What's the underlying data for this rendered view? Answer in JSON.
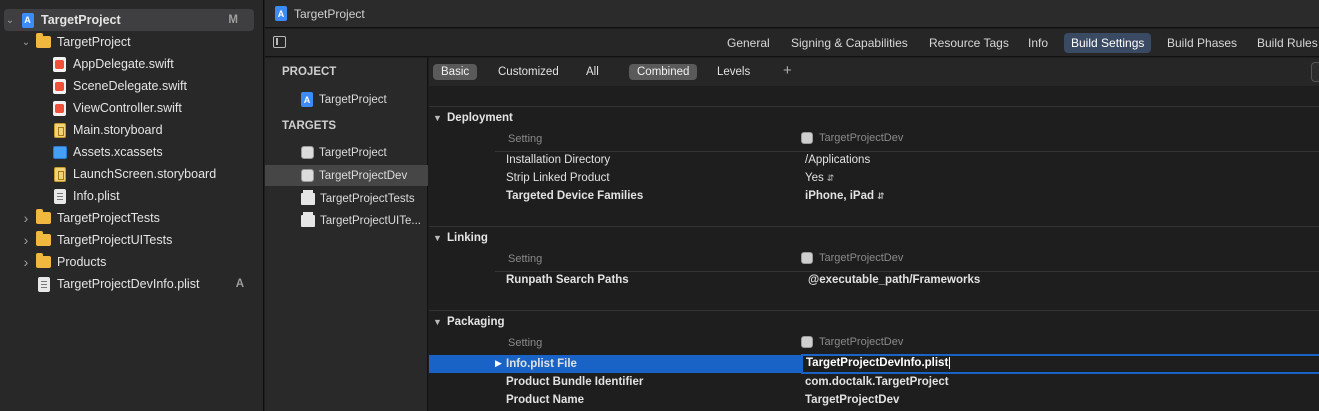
{
  "navigator": {
    "items": [
      {
        "label": "TargetProject",
        "icon": "project-icon",
        "badge": "M",
        "level": 0,
        "expanded": true,
        "bold": true,
        "selected": true
      },
      {
        "label": "TargetProject",
        "icon": "folder-icon",
        "level": 1,
        "expanded": true
      },
      {
        "label": "AppDelegate.swift",
        "icon": "swift-file-icon",
        "level": 2
      },
      {
        "label": "SceneDelegate.swift",
        "icon": "swift-file-icon",
        "level": 2
      },
      {
        "label": "ViewController.swift",
        "icon": "swift-file-icon",
        "level": 2
      },
      {
        "label": "Main.storyboard",
        "icon": "storyboard-icon",
        "level": 2
      },
      {
        "label": "Assets.xcassets",
        "icon": "assets-icon",
        "level": 2
      },
      {
        "label": "LaunchScreen.storyboard",
        "icon": "storyboard-icon",
        "level": 2
      },
      {
        "label": "Info.plist",
        "icon": "plist-icon",
        "level": 2
      },
      {
        "label": "TargetProjectTests",
        "icon": "folder-icon",
        "level": 1,
        "expanded": false
      },
      {
        "label": "TargetProjectUITests",
        "icon": "folder-icon",
        "level": 1,
        "expanded": false
      },
      {
        "label": "Products",
        "icon": "folder-icon",
        "level": 1,
        "expanded": false
      },
      {
        "label": "TargetProjectDevInfo.plist",
        "icon": "plist-icon",
        "badge": "A",
        "level": 1
      }
    ]
  },
  "titlebar": {
    "title": "TargetProject"
  },
  "tabs": [
    "General",
    "Signing & Capabilities",
    "Resource Tags",
    "Info",
    "Build Settings",
    "Build Phases",
    "Build Rules"
  ],
  "active_tab": "Build Settings",
  "targets_panel": {
    "project_header": "PROJECT",
    "project_item": "TargetProject",
    "targets_header": "TARGETS",
    "targets": [
      {
        "label": "TargetProject",
        "icon": "app-target-icon"
      },
      {
        "label": "TargetProjectDev",
        "icon": "app-target-icon",
        "selected": true
      },
      {
        "label": "TargetProjectTests",
        "icon": "test-bundle-icon"
      },
      {
        "label": "TargetProjectUITe...",
        "icon": "test-bundle-icon"
      }
    ]
  },
  "filterbar": {
    "basic": "Basic",
    "customized": "Customized",
    "all": "All",
    "combined": "Combined",
    "levels": "Levels",
    "add": "+"
  },
  "settings": {
    "column_setting": "Setting",
    "column_target": "TargetProjectDev",
    "sections": [
      {
        "title": "Deployment",
        "rows": [
          {
            "key": "Installation Directory",
            "value": "/Applications",
            "bold": false
          },
          {
            "key": "Strip Linked Product",
            "value": "Yes",
            "bold": false,
            "stepper": true
          },
          {
            "key": "Targeted Device Families",
            "value": "iPhone, iPad",
            "bold": true,
            "stepper": true
          }
        ]
      },
      {
        "title": "Linking",
        "rows": [
          {
            "key": "Runpath Search Paths",
            "value": "@executable_path/Frameworks",
            "bold": true
          }
        ]
      },
      {
        "title": "Packaging",
        "rows": [
          {
            "key": "Info.plist File",
            "value": "TargetProjectDevInfo.plist",
            "bold": true,
            "selected": true,
            "editing": true
          },
          {
            "key": "Product Bundle Identifier",
            "value": "com.doctalk.TargetProject",
            "bold": true
          },
          {
            "key": "Product Name",
            "value": "TargetProjectDev",
            "bold": true
          }
        ]
      }
    ]
  },
  "colors": {
    "accent": "#1a63c6",
    "active_tab": "#3a4a63",
    "folder": "#f0b83e",
    "swift": "#f05138",
    "project": "#3b8cf5"
  }
}
